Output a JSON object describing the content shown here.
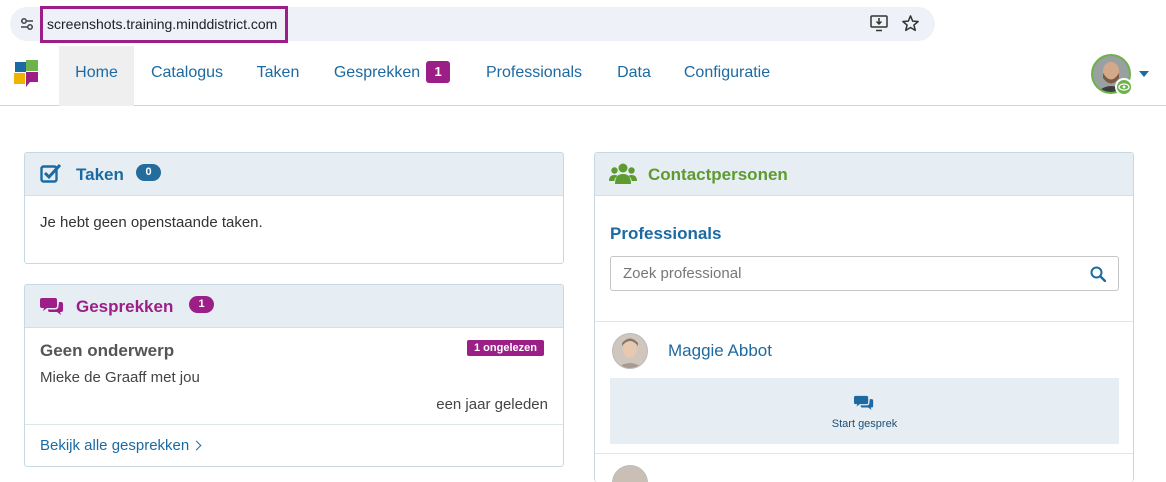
{
  "browser": {
    "url": "screenshots.training.minddistrict.com"
  },
  "nav": {
    "items": [
      {
        "label": "Home",
        "active": true
      },
      {
        "label": "Catalogus"
      },
      {
        "label": "Taken"
      },
      {
        "label": "Gesprekken",
        "badge": "1"
      },
      {
        "label": "Professionals"
      },
      {
        "label": "Data"
      },
      {
        "label": "Configuratie"
      }
    ]
  },
  "taken": {
    "title": "Taken",
    "count": "0",
    "empty_text": "Je hebt geen openstaande taken."
  },
  "gesprekken": {
    "title": "Gesprekken",
    "count": "1",
    "conversation": {
      "subject": "Geen onderwerp",
      "unread": "1 ongelezen",
      "participants": "Mieke de Graaff met jou",
      "time": "een jaar geleden"
    },
    "view_all": "Bekijk alle gesprekken"
  },
  "contacts": {
    "title": "Contactpersonen",
    "section": "Professionals",
    "search_placeholder": "Zoek professional",
    "professionals": [
      {
        "name": "Maggie Abbot",
        "action": "Start gesprek"
      }
    ]
  },
  "colors": {
    "brand_purple": "#9b1f86",
    "link_blue": "#1c6aa1",
    "contacts_green": "#5e9b2f",
    "panel_header": "#e6eef3"
  }
}
